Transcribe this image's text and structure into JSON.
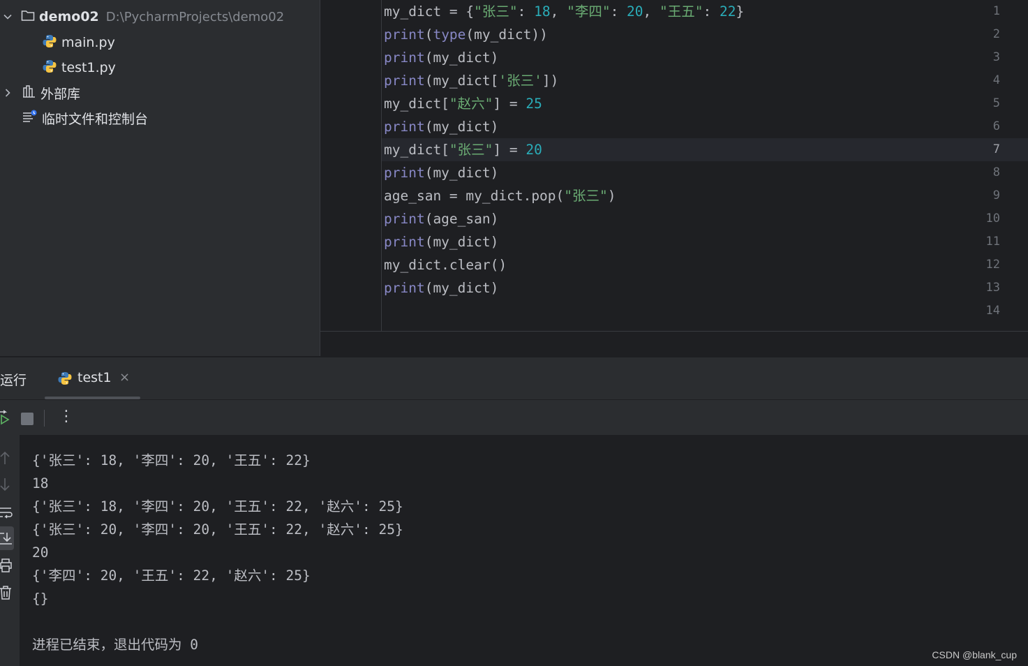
{
  "project": {
    "root_name": "demo02",
    "root_path": "D:\\PycharmProjects\\demo02",
    "files": [
      "main.py",
      "test1.py"
    ],
    "external_libs": "外部库",
    "scratches": "临时文件和控制台",
    "icons": [
      "chevron-down-icon",
      "folder-icon",
      "python-file-icon",
      "chevron-right-icon",
      "library-icon",
      "scratches-icon"
    ]
  },
  "editor": {
    "active_line": 7,
    "line_numbers": [
      "1",
      "2",
      "3",
      "4",
      "5",
      "6",
      "7",
      "8",
      "9",
      "10",
      "11",
      "12",
      "13",
      "14"
    ],
    "lines": [
      "my_dict = {\"张三\": 18, \"李四\": 20, \"王五\": 22}",
      "print(type(my_dict))",
      "print(my_dict)",
      "print(my_dict['张三'])",
      "my_dict[\"赵六\"] = 25",
      "print(my_dict)",
      "my_dict[\"张三\"] = 20",
      "print(my_dict)",
      "age_san = my_dict.pop(\"张三\")",
      "print(age_san)",
      "print(my_dict)",
      "my_dict.clear()",
      "print(my_dict)",
      ""
    ]
  },
  "run": {
    "title": "运行",
    "tab_label": "test1",
    "close_glyph": "×",
    "menu_glyph": "⋮",
    "output": [
      "{'张三': 18, '李四': 20, '王五': 22}",
      "18",
      "{'张三': 18, '李四': 20, '王五': 22, '赵六': 25}",
      "{'张三': 20, '李四': 20, '王五': 22, '赵六': 25}",
      "20",
      "{'李四': 20, '王五': 22, '赵六': 25}",
      "{}",
      "",
      "进程已结束，退出代码为 0"
    ]
  },
  "watermark": "CSDN @blank_cup",
  "colors": {
    "keyword": "#8888c6",
    "string": "#6aab73",
    "number": "#2aacb8",
    "text": "#bcbec4",
    "rerun_green": "#5fb865"
  }
}
